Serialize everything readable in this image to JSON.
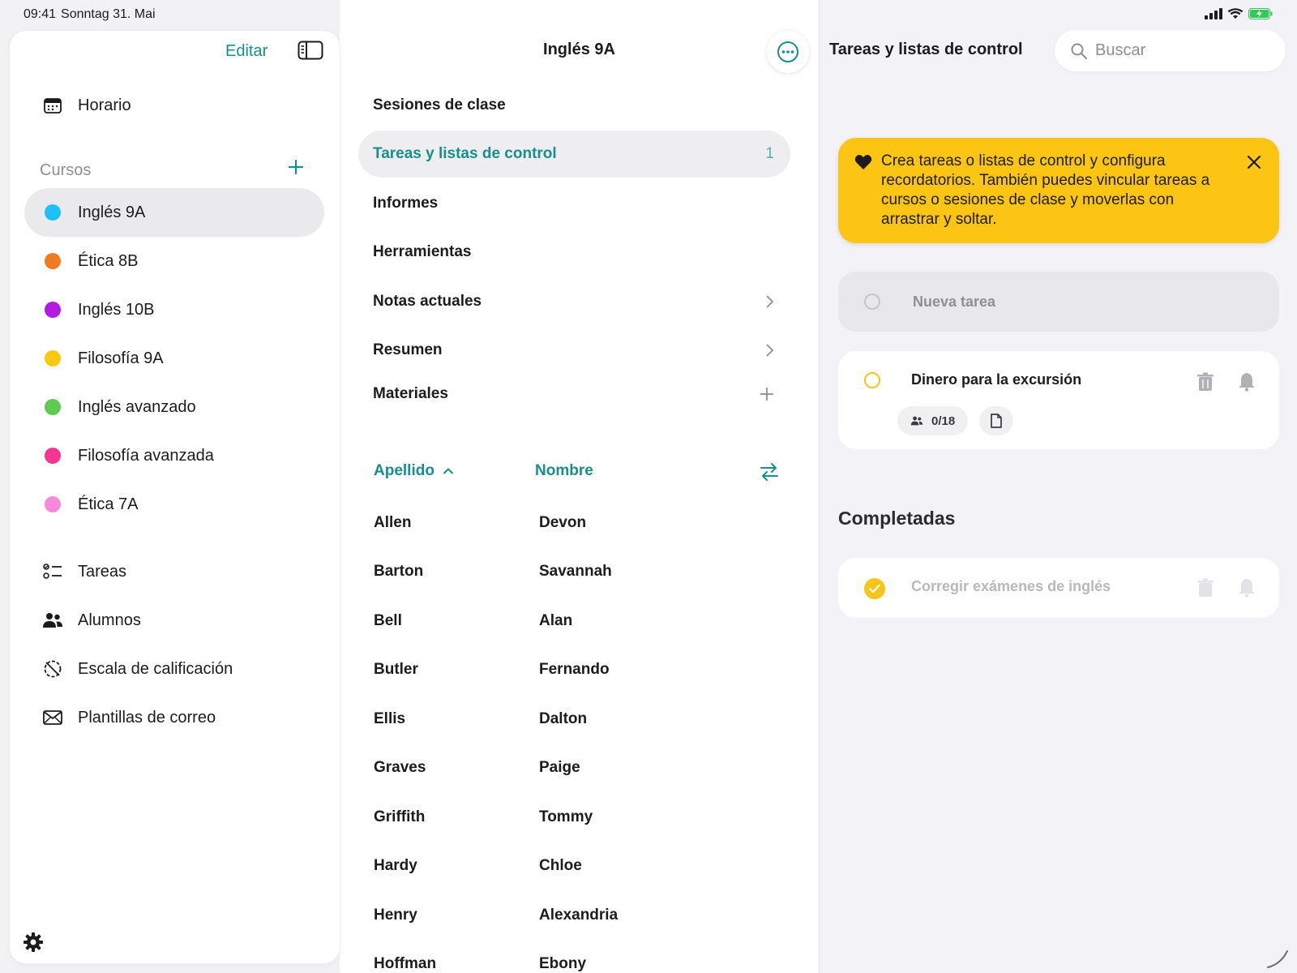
{
  "status_bar": {
    "time": "09:41",
    "date": "Sonntag 31. Mai"
  },
  "sidebar": {
    "edit_label": "Editar",
    "schedule_label": "Horario",
    "courses_header": "Cursos",
    "courses": [
      {
        "label": "Inglés 9A",
        "color": "#1ec0f5",
        "selected": true
      },
      {
        "label": "Ética 8B",
        "color": "#f47a1f"
      },
      {
        "label": "Inglés 10B",
        "color": "#b41be0"
      },
      {
        "label": "Filosofía 9A",
        "color": "#fcc812"
      },
      {
        "label": "Inglés avanzado",
        "color": "#5ccc4f"
      },
      {
        "label": "Filosofía avanzada",
        "color": "#f7368f"
      },
      {
        "label": "Ética 7A",
        "color": "#f58ad8"
      }
    ],
    "nav": [
      {
        "label": "Tareas",
        "icon": "checklist-icon"
      },
      {
        "label": "Alumnos",
        "icon": "people-icon"
      },
      {
        "label": "Escala de calificación",
        "icon": "grading-scale-icon"
      },
      {
        "label": "Plantillas de correo",
        "icon": "envelope-icon"
      }
    ]
  },
  "middle": {
    "title": "Inglés 9A",
    "menu": [
      {
        "label": "Sesiones de clase"
      },
      {
        "label": "Tareas y listas de control",
        "count": "1",
        "selected": true
      },
      {
        "label": "Informes"
      },
      {
        "label": "Herramientas"
      },
      {
        "label": "Notas actuales",
        "trail": "chevron-right-icon"
      },
      {
        "label": "Resumen",
        "trail": "chevron-right-icon"
      },
      {
        "label": "Materiales",
        "trail": "plus-icon"
      }
    ],
    "sort": {
      "last_name": "Apellido",
      "first_name": "Nombre"
    },
    "students": [
      {
        "last": "Allen",
        "first": "Devon"
      },
      {
        "last": "Barton",
        "first": "Savannah"
      },
      {
        "last": "Bell",
        "first": "Alan"
      },
      {
        "last": "Butler",
        "first": "Fernando"
      },
      {
        "last": "Ellis",
        "first": "Dalton"
      },
      {
        "last": "Graves",
        "first": "Paige"
      },
      {
        "last": "Griffith",
        "first": "Tommy"
      },
      {
        "last": "Hardy",
        "first": "Chloe"
      },
      {
        "last": "Henry",
        "first": "Alexandria"
      },
      {
        "last": "Hoffman",
        "first": "Ebony"
      }
    ]
  },
  "right": {
    "title": "Tareas y listas de control",
    "search_placeholder": "Buscar",
    "tip_text": "Crea tareas o listas de control y configura recordatorios. También puedes vincular tareas a cursos o sesiones de clase y moverlas con arrastrar y soltar.",
    "new_task_placeholder": "Nueva tarea",
    "tasks": [
      {
        "title": "Dinero para la excursión",
        "progress": "0/18"
      }
    ],
    "completed_header": "Completadas",
    "completed": [
      {
        "title": "Corregir exámenes de inglés"
      }
    ]
  },
  "colors": {
    "accent": "#188f8a",
    "tip_bg": "#fcc514",
    "check": "#f5c518"
  }
}
